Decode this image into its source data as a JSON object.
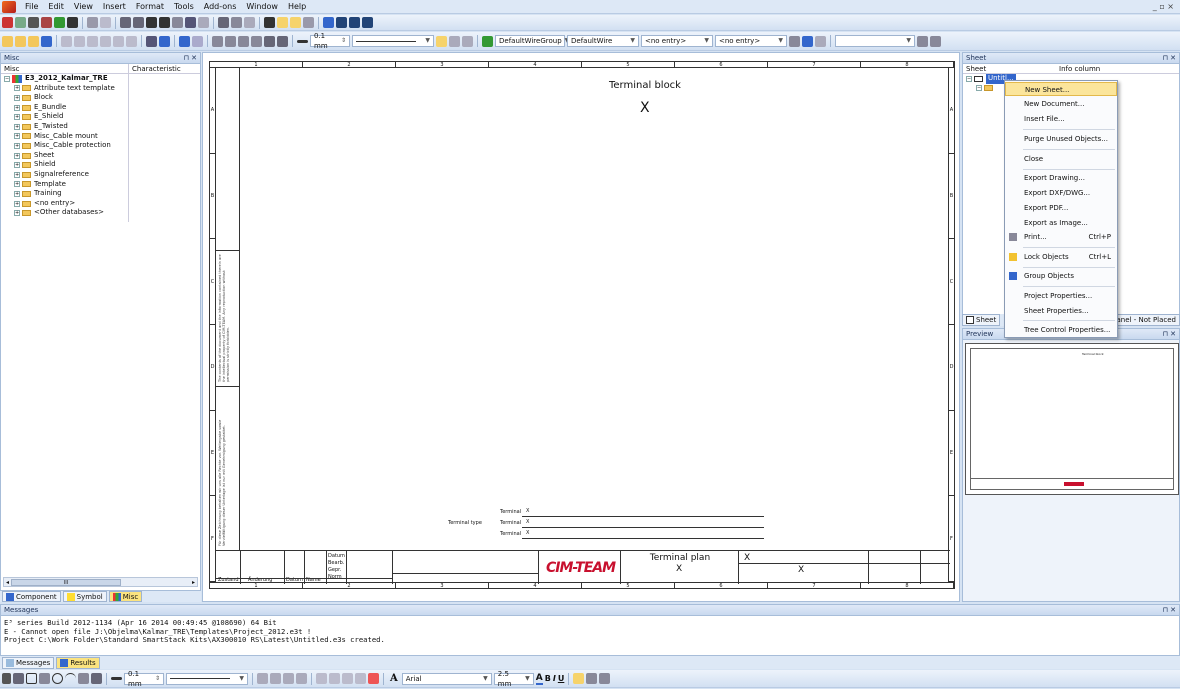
{
  "menu": {
    "items": [
      "File",
      "Edit",
      "View",
      "Insert",
      "Format",
      "Tools",
      "Add-ons",
      "Window",
      "Help"
    ],
    "window_controls": "_ ▫ ×"
  },
  "toolbar2": {
    "line_width": "0.1 mm",
    "wire_group": "DefaultWireGroup",
    "wire": "DefaultWire",
    "entry1": "<no entry>",
    "entry2": "<no entry>"
  },
  "misc_panel": {
    "title": "Misc",
    "col_misc": "Misc",
    "col_char": "Characteristic",
    "root": "E3_2012_Kalmar_TRE",
    "items": [
      "Attribute text template",
      "Block",
      "E_Bundle",
      "E_Shield",
      "E_Twisted",
      "Misc_Cable mount",
      "Misc_Cable protection",
      "Sheet",
      "Shield",
      "Signalreference",
      "Template",
      "Training",
      "<no entry>",
      "<Other databases>"
    ],
    "scroll_label": "III",
    "tabs": [
      "Component",
      "Symbol",
      "Misc"
    ]
  },
  "drawing": {
    "top_ruler": [
      "1",
      "2",
      "3",
      "4",
      "5",
      "6",
      "7",
      "8"
    ],
    "side_ruler": [
      "A",
      "B",
      "C",
      "D",
      "E",
      "F"
    ],
    "terminal_block": "Terminal block",
    "x_mark": "X",
    "terminal_type": "Terminal type",
    "terminal_rows": [
      "Terminal",
      "Terminal",
      "Terminal"
    ],
    "terminal_vals": [
      "X",
      "X",
      "X"
    ],
    "logo": "CIM-TEAM",
    "plan_title": "Terminal plan",
    "plan_x": "X",
    "plan_x2": "X",
    "plan_x3": "X",
    "tb_labels": [
      "Datum",
      "Bearb.",
      "Gepr.",
      "Norm"
    ],
    "tb_bottom": [
      "Zustand",
      "Änderung",
      "Datum",
      "Name"
    ],
    "strip_text_1": "The contents of the document and the information contained therein are the intellectual property of CIM-TEAM. Any reproduction without permission is strictly forbidden.",
    "strip_text_2": "Für diese Zeichnung behalten wir uns alle Rechte vor. Weitergabe sowie Vervielfältigung dieser Unterlage ist nur mit Genehmigung gestattet."
  },
  "sheet_panel": {
    "title": "Sheet",
    "col_sheet": "Sheet",
    "col_info": "Info column",
    "item": "Untitl...",
    "tab_sheet": "Sheet",
    "tab_right": "anel - Not Placed"
  },
  "preview": {
    "title": "Preview"
  },
  "context_menu": {
    "items": [
      {
        "label": "New Sheet...",
        "shortcut": ""
      },
      {
        "label": "New Document...",
        "shortcut": ""
      },
      {
        "label": "Insert File...",
        "shortcut": ""
      },
      {
        "label": "Purge Unused Objects...",
        "shortcut": ""
      },
      {
        "label": "Close",
        "shortcut": ""
      },
      {
        "label": "Export Drawing...",
        "shortcut": ""
      },
      {
        "label": "Export DXF/DWG...",
        "shortcut": ""
      },
      {
        "label": "Export PDF...",
        "shortcut": ""
      },
      {
        "label": "Export as Image...",
        "shortcut": ""
      },
      {
        "label": "Print...",
        "shortcut": "Ctrl+P"
      },
      {
        "label": "Lock Objects",
        "shortcut": "Ctrl+L"
      },
      {
        "label": "Group Objects",
        "shortcut": ""
      },
      {
        "label": "Project Properties...",
        "shortcut": ""
      },
      {
        "label": "Sheet Properties...",
        "shortcut": ""
      },
      {
        "label": "Tree Control Properties...",
        "shortcut": ""
      }
    ]
  },
  "messages": {
    "title": "Messages",
    "lines": [
      "E³ series Build 2012-1134 (Apr 16 2014 00:49:45 @108690) 64 Bit",
      "E - Cannot open file J:\\Objelma\\Kalmar_TRE\\Templates\\Project_2012.e3t !",
      "Project C:\\Work Folder\\Standard SmartStack Kits\\AX300010 RS\\Latest\\Untitled.e3s created."
    ],
    "tabs": [
      "Messages",
      "Results"
    ]
  },
  "bottom_toolbar": {
    "line_width": "0.1 mm",
    "font": "Arial",
    "font_size": "2.5 mm"
  }
}
